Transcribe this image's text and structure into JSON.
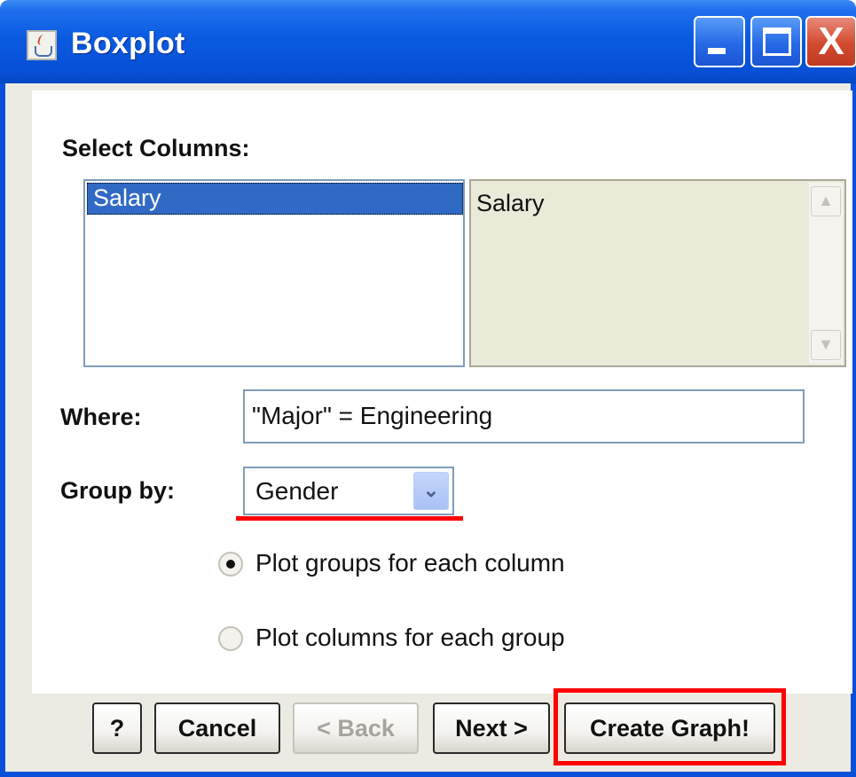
{
  "window": {
    "title": "Boxplot",
    "icon": "java-cup-icon",
    "controls": {
      "minimize_icon": "minimize-icon",
      "maximize_icon": "maximize-icon",
      "close_label": "X"
    }
  },
  "select_columns": {
    "label": "Select Columns:",
    "available": [
      "Salary"
    ],
    "selected": [
      "Salary"
    ],
    "scroll_up": "▲",
    "scroll_down": "▼"
  },
  "where": {
    "label": "Where:",
    "value": "\"Major\" = Engineering"
  },
  "group_by": {
    "label": "Group by:",
    "value": "Gender",
    "arrow": "⌄"
  },
  "plot_options": [
    {
      "label": "Plot groups for each column",
      "checked": true
    },
    {
      "label": "Plot columns for each group",
      "checked": false
    }
  ],
  "buttons": {
    "help": "?",
    "cancel": "Cancel",
    "back": "< Back",
    "next": "Next >",
    "create": "Create Graph!"
  },
  "colors": {
    "highlight": "#ff0000",
    "selection": "#316ac5",
    "titlebar": "#0a5be0"
  }
}
